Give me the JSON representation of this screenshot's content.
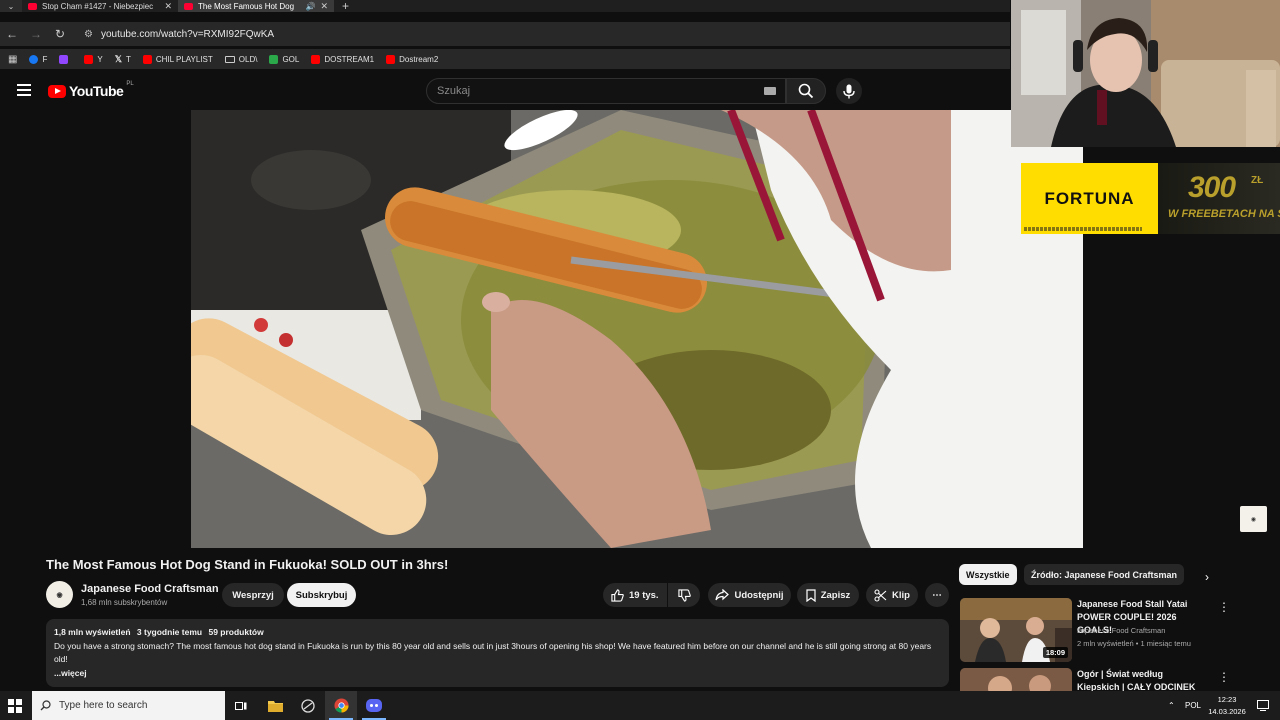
{
  "browser": {
    "tabs": [
      {
        "title": "Stop Cham #1427 - Niebezpiec",
        "active": false
      },
      {
        "title": "The Most Famous Hot Dog",
        "active": true
      }
    ],
    "url": "youtube.com/watch?v=RXMI92FQwKA",
    "bookmarks": [
      {
        "label": "F",
        "icon": "facebook-icon",
        "color": "#1877f2"
      },
      {
        "label": "",
        "icon": "twitch-icon",
        "color": "#9146ff"
      },
      {
        "label": "Y",
        "icon": "youtube-icon",
        "color": "#ff0000"
      },
      {
        "label": "T",
        "icon": "x-icon",
        "color": "#ffffff"
      },
      {
        "label": "CHIL PLAYLIST",
        "icon": "youtube-icon",
        "color": "#ff0000"
      },
      {
        "label": "OLD\\",
        "icon": "folder-icon",
        "color": "#cccccc"
      },
      {
        "label": "GOL",
        "icon": "gol-icon",
        "color": "#2aa84a"
      },
      {
        "label": "DOSTREAM1",
        "icon": "youtube-icon",
        "color": "#ff0000"
      },
      {
        "label": "Dostream2",
        "icon": "youtube-icon",
        "color": "#ff0000"
      }
    ]
  },
  "youtube": {
    "logo_text": "YouTube",
    "region": "PL",
    "search_placeholder": "Szukaj"
  },
  "ad": {
    "brand": "FORTUNA",
    "amount": "300",
    "currency": "ZŁ",
    "tagline": "W FREEBETACH NA START"
  },
  "video": {
    "title": "The Most Famous Hot Dog Stand in Fukuoka! SOLD OUT in 3hrs!",
    "channel": "Japanese Food Craftsman",
    "subscribers": "1,68 mln subskrybentów",
    "support_label": "Wesprzyj",
    "subscribe_label": "Subskrybuj",
    "likes": "19 tys.",
    "share_label": "Udostępnij",
    "save_label": "Zapisz",
    "clip_label": "Klip",
    "views": "1,8 mln wyświetleń",
    "age": "3 tygodnie temu",
    "products": "59 produktów",
    "description": "Do you have a strong stomach? The most famous hot dog stand in Fukuoka is run by this 80 year old and sells out in just 3hours of opening his shop! We have featured him before on our channel and he is still going strong at 80 years old!",
    "more_label": "...więcej"
  },
  "recommendations": {
    "chips": [
      "Wszystkie",
      "Źródło: Japanese Food Craftsman"
    ],
    "items": [
      {
        "title": "Japanese Food Stall Yatai POWER COUPLE! 2026 GOALS!",
        "channel": "Japanese Food Craftsman",
        "meta": "2 mln wyświetleń • 1 miesiąc temu",
        "duration": "18:09"
      },
      {
        "title": "Ogór | Świat według Kiepskich | CAŁY ODCINEK",
        "channel": "",
        "meta": "",
        "duration": ""
      }
    ]
  },
  "taskbar": {
    "search_placeholder": "Type here to search",
    "language": "POL",
    "time": "12:23",
    "date": "14.03.2026"
  }
}
